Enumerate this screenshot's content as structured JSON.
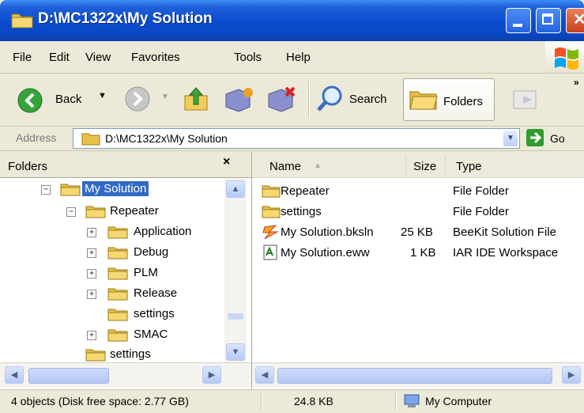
{
  "window": {
    "title": "D:\\MC1322x\\My Solution"
  },
  "menu": [
    "File",
    "Edit",
    "View",
    "Favorites",
    "Tools",
    "Help"
  ],
  "toolbar": {
    "back_label": "Back",
    "search_label": "Search",
    "folders_label": "Folders"
  },
  "address": {
    "label": "Address",
    "value": "D:\\MC1322x\\My Solution",
    "go_label": "Go"
  },
  "folders_pane": {
    "title": "Folders",
    "close_glyph": "×",
    "tree": [
      {
        "label": "My Solution",
        "expander": "−",
        "selected": true
      },
      {
        "label": "Repeater",
        "expander": "−"
      },
      {
        "label": "Application",
        "expander": "+"
      },
      {
        "label": "Debug",
        "expander": "+"
      },
      {
        "label": "PLM",
        "expander": "+"
      },
      {
        "label": "Release",
        "expander": "+"
      },
      {
        "label": "settings",
        "expander": ""
      },
      {
        "label": "SMAC",
        "expander": "+"
      },
      {
        "label": "settings",
        "expander": ""
      }
    ]
  },
  "list": {
    "columns": {
      "name": "Name",
      "size": "Size",
      "type": "Type"
    },
    "rows": [
      {
        "name": "Repeater",
        "size": "",
        "type": "File Folder",
        "icon": "folder-icon"
      },
      {
        "name": "settings",
        "size": "",
        "type": "File Folder",
        "icon": "folder-icon"
      },
      {
        "name": "My Solution.bksln",
        "size": "25 KB",
        "type": "BeeKit Solution File",
        "icon": "beekit-icon"
      },
      {
        "name": "My Solution.eww",
        "size": "1 KB",
        "type": "IAR IDE Workspace",
        "icon": "iar-workspace-icon"
      }
    ]
  },
  "status": {
    "objects": "4 objects (Disk free space: 2.77 GB)",
    "size": "24.8 KB",
    "location": "My Computer"
  }
}
